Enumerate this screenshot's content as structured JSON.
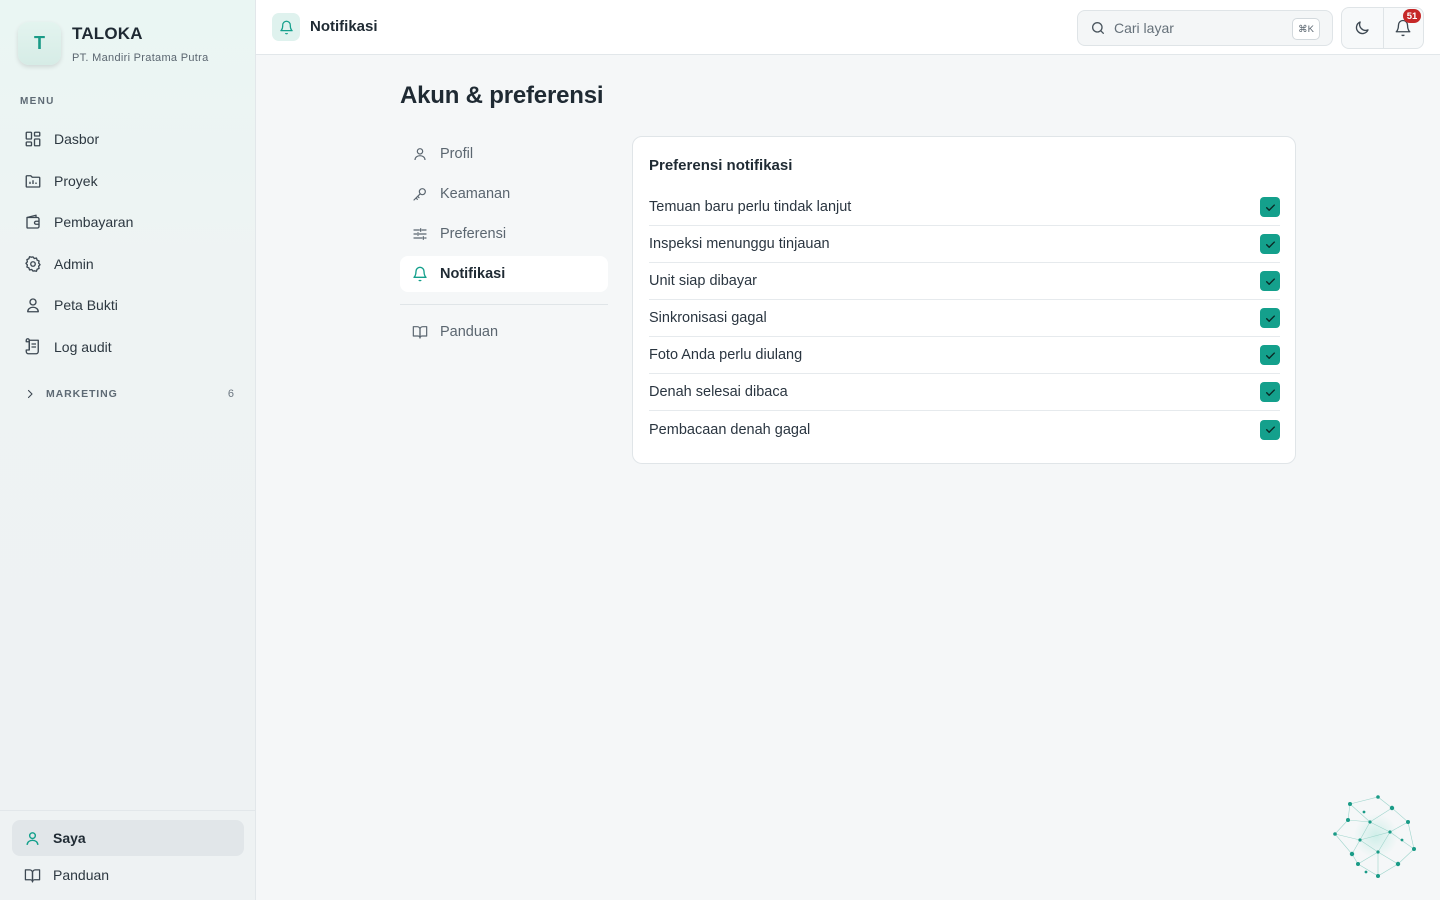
{
  "brand": {
    "logo_letter": "T",
    "name": "TALOKA",
    "org": "PT. Mandiri Pratama Putra"
  },
  "sidebar": {
    "menu_title": "MENU",
    "items": [
      {
        "label": "Dasbor",
        "icon": "dashboard-icon"
      },
      {
        "label": "Proyek",
        "icon": "project-icon"
      },
      {
        "label": "Pembayaran",
        "icon": "wallet-icon"
      },
      {
        "label": "Admin",
        "icon": "gear-icon"
      },
      {
        "label": "Peta Bukti",
        "icon": "map-pin-user-icon"
      },
      {
        "label": "Log audit",
        "icon": "audit-log-icon"
      }
    ],
    "group": {
      "label": "MARKETING",
      "count": "6",
      "icon": "chevron-right-icon"
    },
    "bottom": [
      {
        "label": "Saya",
        "icon": "user-icon",
        "active": true
      },
      {
        "label": "Panduan",
        "icon": "book-icon",
        "active": false
      }
    ]
  },
  "topbar": {
    "title": "Notifikasi",
    "icon": "bell-icon",
    "search": {
      "placeholder": "Cari layar",
      "shortcut": "⌘K"
    },
    "notification_count": "51"
  },
  "main": {
    "page_title": "Akun & preferensi",
    "subnav": [
      {
        "label": "Profil",
        "icon": "user-icon"
      },
      {
        "label": "Keamanan",
        "icon": "key-icon"
      },
      {
        "label": "Preferensi",
        "icon": "sliders-icon"
      },
      {
        "label": "Notifikasi",
        "icon": "bell-icon",
        "active": true
      }
    ],
    "subnav_extra": {
      "label": "Panduan",
      "icon": "book-icon"
    },
    "card": {
      "title": "Preferensi notifikasi",
      "items": [
        {
          "label": "Temuan baru perlu tindak lanjut",
          "checked": true
        },
        {
          "label": "Inspeksi menunggu tinjauan",
          "checked": true
        },
        {
          "label": "Unit siap dibayar",
          "checked": true
        },
        {
          "label": "Sinkronisasi gagal",
          "checked": true
        },
        {
          "label": "Foto Anda perlu diulang",
          "checked": true
        },
        {
          "label": "Denah selesai dibaca",
          "checked": true
        },
        {
          "label": "Pembacaan denah gagal",
          "checked": true
        }
      ]
    }
  },
  "colors": {
    "accent": "#14a08c",
    "badge": "#c62828",
    "sidebar_bg": "#eef2f3"
  }
}
